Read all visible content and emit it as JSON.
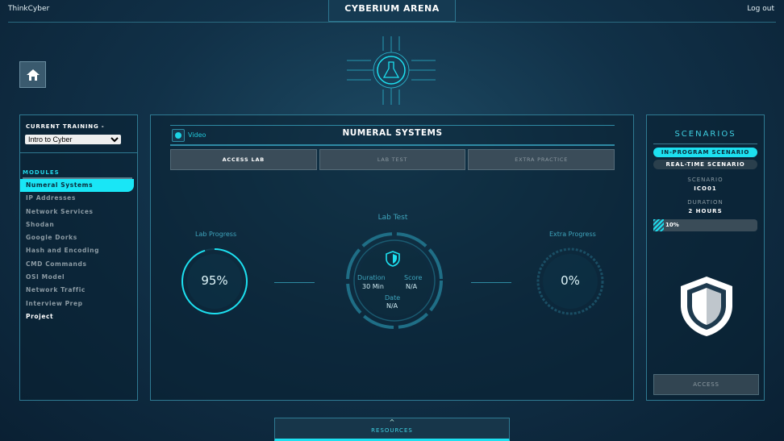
{
  "header": {
    "brand": "ThinkCyber",
    "title": "CYBERIUM ARENA",
    "logout": "Log out"
  },
  "sidebar": {
    "current_training_label": "CURRENT TRAINING -",
    "training_selected": "Intro to Cyber",
    "modules_label": "MODULES",
    "modules": [
      "Numeral Systems",
      "IP Addresses",
      "Network Services",
      "Shodan",
      "Google Dorks",
      "Hash and Encoding",
      "CMD Commands",
      "OSI Model",
      "Network Traffic",
      "Interview Prep",
      "Project"
    ]
  },
  "main": {
    "video_label": "Video",
    "title": "NUMERAL SYSTEMS",
    "tabs": [
      "ACCESS LAB",
      "LAB TEST",
      "EXTRA PRACTICE"
    ],
    "lab_progress_label": "Lab Progress",
    "lab_progress_value": "95%",
    "lab_progress_fraction": 0.95,
    "lab_test": {
      "title": "Lab Test",
      "duration_label": "Duration",
      "duration": "30 Min",
      "score_label": "Score",
      "score": "N/A",
      "date_label": "Date",
      "date": "N/A"
    },
    "extra_progress_label": "Extra Progress",
    "extra_progress_value": "0%"
  },
  "scenarios": {
    "title": "SCENARIOS",
    "in_program": "IN-PROGRAM SCENARIO",
    "real_time": "REAL-TIME SCENARIO",
    "scenario_label": "SCENARIO",
    "scenario": "ICO01",
    "duration_label": "DURATION",
    "duration": "2 HOURS",
    "progress": "10%",
    "progress_fraction": 0.1,
    "access": "ACCESS"
  },
  "footer": {
    "resources": "RESOURCES",
    "chevron": "^"
  }
}
